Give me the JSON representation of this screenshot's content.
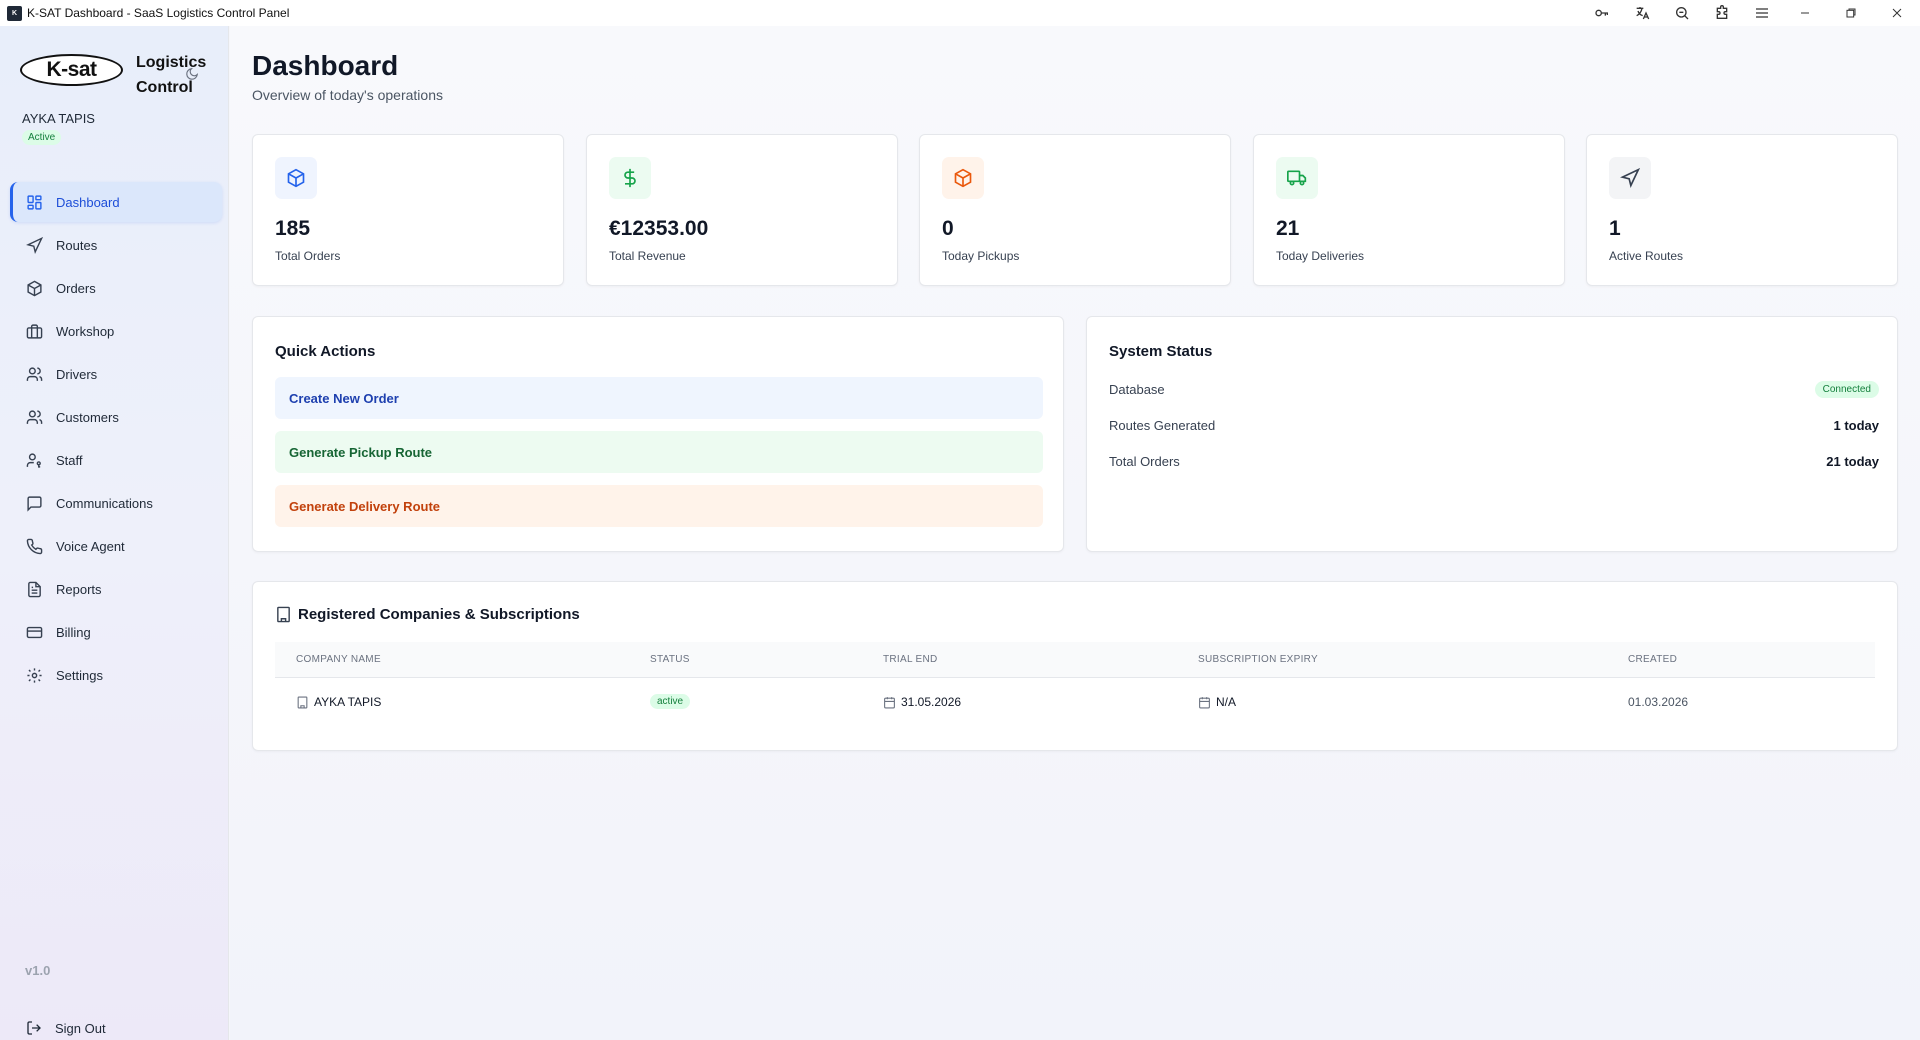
{
  "window": {
    "title": "K-SAT Dashboard - SaaS Logistics Control Panel",
    "app_icon_text": "K"
  },
  "sidebar": {
    "logo_text": "K-sat",
    "brand_line1": "Logistics",
    "brand_line2": "Control",
    "user_name": "AYKA TAPIS",
    "user_status": "Active",
    "items": [
      {
        "label": "Dashboard",
        "icon": "dashboard-icon",
        "active": true
      },
      {
        "label": "Routes",
        "icon": "navigation-icon"
      },
      {
        "label": "Orders",
        "icon": "package-icon"
      },
      {
        "label": "Workshop",
        "icon": "briefcase-icon"
      },
      {
        "label": "Drivers",
        "icon": "users-icon"
      },
      {
        "label": "Customers",
        "icon": "users-icon"
      },
      {
        "label": "Staff",
        "icon": "user-key-icon"
      },
      {
        "label": "Communications",
        "icon": "message-icon"
      },
      {
        "label": "Voice Agent",
        "icon": "phone-icon"
      },
      {
        "label": "Reports",
        "icon": "file-text-icon"
      },
      {
        "label": "Billing",
        "icon": "credit-card-icon"
      },
      {
        "label": "Settings",
        "icon": "gear-icon"
      }
    ],
    "version": "v1.0",
    "sign_out": "Sign Out"
  },
  "header": {
    "title": "Dashboard",
    "subtitle": "Overview of today's operations"
  },
  "stats": [
    {
      "value": "185",
      "label": "Total Orders",
      "icon": "package-icon",
      "color": "#2563eb",
      "bg": "#eff4fe"
    },
    {
      "value": "€12353.00",
      "label": "Total Revenue",
      "icon": "dollar-icon",
      "color": "#16a34a",
      "bg": "#ecfbf1"
    },
    {
      "value": "0",
      "label": "Today Pickups",
      "icon": "package-icon",
      "color": "#ea580c",
      "bg": "#fff3ea"
    },
    {
      "value": "21",
      "label": "Today Deliveries",
      "icon": "truck-icon",
      "color": "#16a34a",
      "bg": "#ecfbf1"
    },
    {
      "value": "1",
      "label": "Active Routes",
      "icon": "navigation-icon",
      "color": "#374151",
      "bg": "#f3f4f6"
    }
  ],
  "quick_actions": {
    "title": "Quick Actions",
    "create_order": "Create New Order",
    "pickup_route": "Generate Pickup Route",
    "delivery_route": "Generate Delivery Route"
  },
  "system_status": {
    "title": "System Status",
    "rows": [
      {
        "label": "Database",
        "value": "Connected"
      },
      {
        "label": "Routes Generated",
        "value": "1 today"
      },
      {
        "label": "Total Orders",
        "value": "21 today"
      }
    ]
  },
  "companies": {
    "title": "Registered Companies & Subscriptions",
    "columns": [
      "COMPANY NAME",
      "STATUS",
      "TRIAL END",
      "SUBSCRIPTION EXPIRY",
      "CREATED"
    ],
    "rows": [
      {
        "name": "AYKA TAPIS",
        "status": "active",
        "trial_end": "31.05.2026",
        "expiry": "N/A",
        "created": "01.03.2026"
      }
    ]
  }
}
